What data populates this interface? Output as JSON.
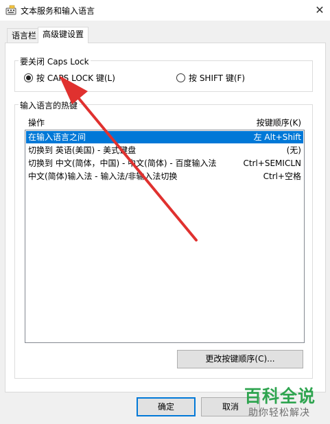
{
  "window": {
    "title": "文本服务和输入语言",
    "close_label": "✕"
  },
  "tabs": [
    {
      "label": "语言栏",
      "active": false
    },
    {
      "label": "高级键设置",
      "active": true
    }
  ],
  "caps_lock_group": {
    "title": "要关闭 Caps Lock",
    "options": [
      {
        "label": "按 CAPS LOCK 键(L)",
        "selected": true
      },
      {
        "label": "按 SHIFT 键(F)",
        "selected": false
      }
    ]
  },
  "hotkeys_group": {
    "title": "输入语言的热键",
    "columns": {
      "action": "操作",
      "key_sequence": "按键顺序(K)"
    },
    "rows": [
      {
        "action": "在输入语言之间",
        "keys": "左 Alt+Shift",
        "selected": true
      },
      {
        "action": "切换到 英语(美国) - 美式键盘",
        "keys": "(无)",
        "selected": false
      },
      {
        "action": "切换到 中文(简体，中国) - 中文(简体) - 百度输入法",
        "keys": "Ctrl+SEMICLN",
        "selected": false
      },
      {
        "action": "中文(简体)输入法 - 输入法/非输入法切换",
        "keys": "Ctrl+空格",
        "selected": false
      }
    ],
    "change_button": "更改按键顺序(C)..."
  },
  "footer": {
    "ok_label": "确定",
    "cancel_label": "取消"
  },
  "watermark": {
    "logo": "百科全说",
    "subtitle": "助你轻松解决"
  },
  "colors": {
    "selection": "#0078d7",
    "annotation_arrow": "#e0312f",
    "watermark_green": "#2ea44f"
  },
  "icons": {
    "app": "keyboard-icon",
    "close": "close-icon",
    "annotation": "red-arrow-annotation"
  }
}
